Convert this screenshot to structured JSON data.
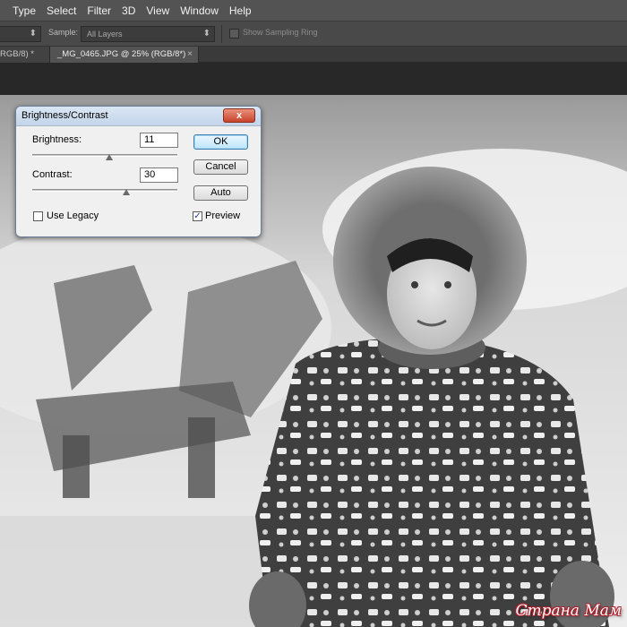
{
  "menubar": {
    "items": [
      "Type",
      "Select",
      "Filter",
      "3D",
      "View",
      "Window",
      "Help"
    ]
  },
  "options": {
    "sample_label": "Sample:",
    "sample_value": "All Layers",
    "sampling_ring_label": "Show Sampling Ring"
  },
  "tabs": [
    {
      "label": "RGB/8) *"
    },
    {
      "label": "_MG_0465.JPG @ 25% (RGB/8*) *"
    }
  ],
  "dialog": {
    "title": "Brightness/Contrast",
    "close_glyph": "x",
    "brightness": {
      "label": "Brightness:",
      "value": "11",
      "slider_level": 0.53
    },
    "contrast": {
      "label": "Contrast:",
      "value": "30",
      "slider_level": 0.65
    },
    "use_legacy": {
      "label": "Use Legacy",
      "checked": false
    },
    "preview": {
      "label": "Preview",
      "checked": true,
      "glyph": "✓"
    },
    "buttons": {
      "ok": "OK",
      "cancel": "Cancel",
      "auto": "Auto"
    }
  },
  "watermark": "Страна Мам",
  "icons": [
    "chevron-updown-icon",
    "close-icon",
    "checkmark-icon"
  ]
}
